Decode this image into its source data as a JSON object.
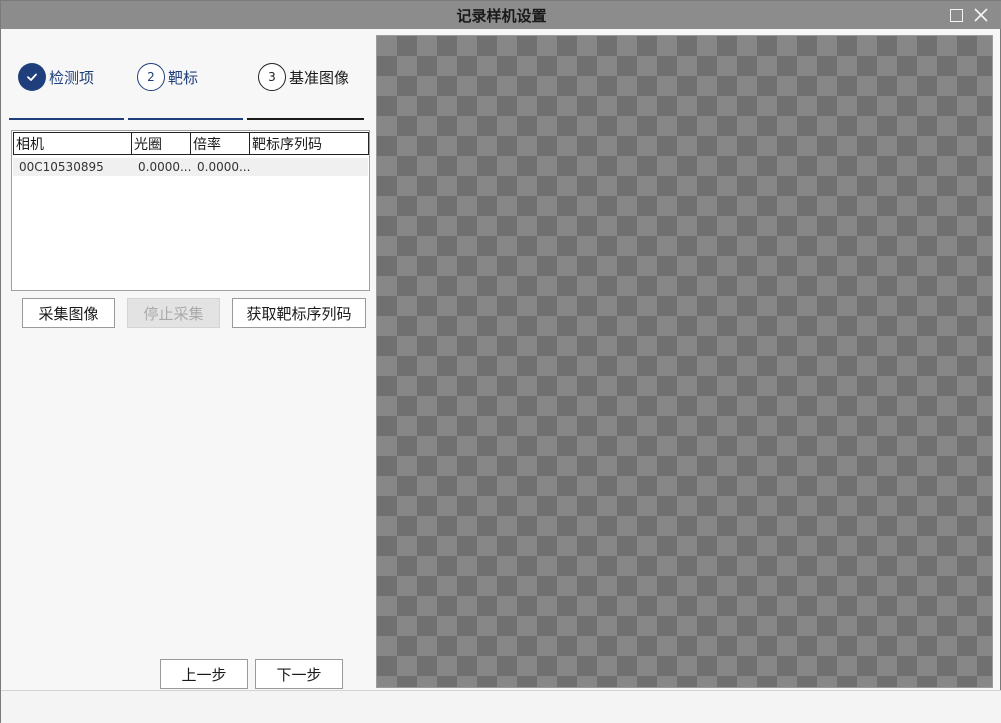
{
  "window": {
    "title": "记录样机设置"
  },
  "steps": [
    {
      "number": "",
      "label": "检测项",
      "state": "done"
    },
    {
      "number": "2",
      "label": "靶标",
      "state": "active"
    },
    {
      "number": "3",
      "label": "基准图像",
      "state": "pending"
    }
  ],
  "table": {
    "columns": [
      "相机",
      "光圈",
      "倍率",
      "靶标序列码"
    ],
    "rows": [
      {
        "camera": "00C10530895",
        "aperture": "0.0000...",
        "magnification": "0.0000...",
        "target_serial": ""
      }
    ]
  },
  "buttons": {
    "capture_image": "采集图像",
    "stop_capture": "停止采集",
    "get_target_serial": "获取靶标序列码",
    "previous_step": "上一步",
    "next_step": "下一步"
  },
  "colors": {
    "accent": "#1e3f7c",
    "titlebar": "#8c8c8c",
    "checker_light": "#878787",
    "checker_dark": "#707070"
  },
  "icons": {
    "step1": "check-icon",
    "maximize": "maximize-icon",
    "close": "close-icon"
  }
}
